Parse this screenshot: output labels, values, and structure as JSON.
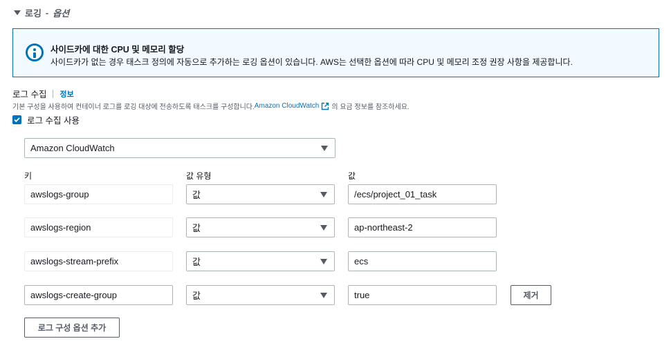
{
  "section": {
    "title": "로깅",
    "subtitle": "옵션"
  },
  "info_box": {
    "title": "사이드카에 대한 CPU 및 메모리 할당",
    "text": "사이드카가 없는 경우 태스크 정의에 자동으로 추가하는 로깅 옵션이 있습니다. AWS는 선택한 옵션에 따라 CPU 및 메모리 조정 권장 사항을 제공합니다."
  },
  "log_collection": {
    "label": "로그 수집",
    "info_link": "정보",
    "desc_before": "기본 구성을 사용하여 컨테이너 로그를 로깅 대상에 전송하도록 태스크를 구성합니다. ",
    "desc_link": "Amazon CloudWatch",
    "desc_after": "의 요금 정보를 참조하세요.",
    "checkbox_label": "로그 수집 사용",
    "checked": true
  },
  "destination": {
    "value": "Amazon CloudWatch"
  },
  "columns": {
    "key": "키",
    "value_type": "값 유형",
    "value": "값"
  },
  "rows": [
    {
      "key": "awslogs-group",
      "type": "값",
      "value": "/ecs/project_01_task"
    },
    {
      "key": "awslogs-region",
      "type": "값",
      "value": "ap-northeast-2"
    },
    {
      "key": "awslogs-stream-prefix",
      "type": "값",
      "value": "ecs"
    },
    {
      "key": "awslogs-create-group",
      "type": "값",
      "value": "true"
    }
  ],
  "remove_button": "제거",
  "add_button": "로그 구성 옵션 추가"
}
